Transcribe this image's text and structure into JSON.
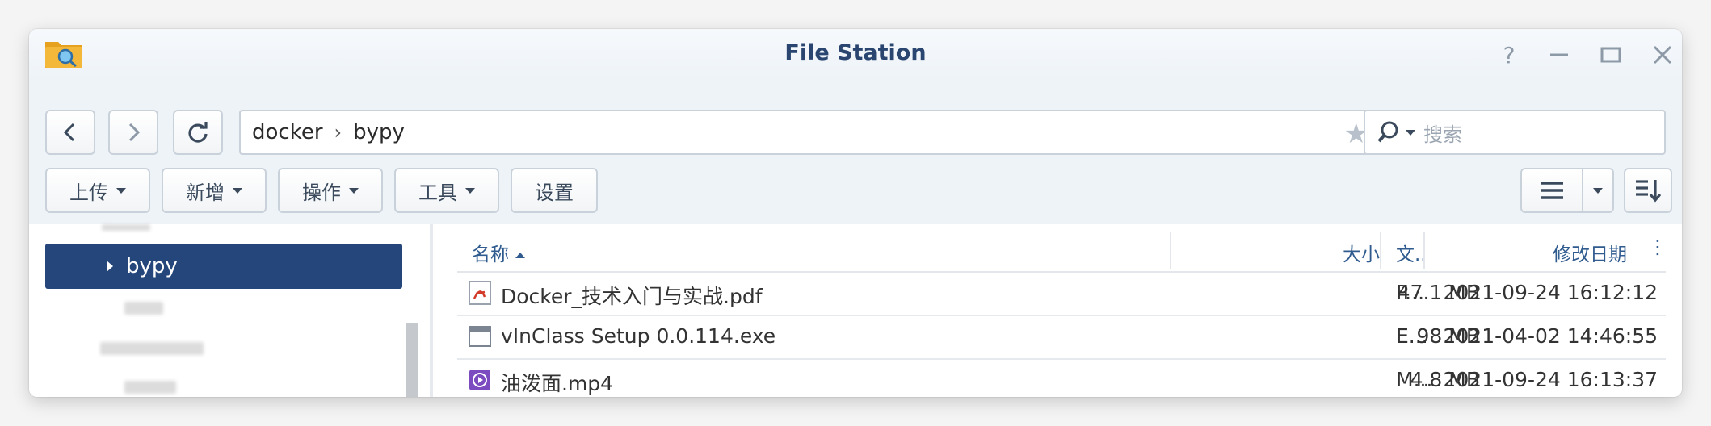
{
  "window": {
    "title": "File Station"
  },
  "nav": {
    "back": "‹",
    "forward": "›"
  },
  "path": {
    "segments": [
      "docker",
      "bypy"
    ],
    "separator": "›"
  },
  "search": {
    "placeholder": "搜索"
  },
  "actions": {
    "upload": "上传",
    "create": "新增",
    "operate": "操作",
    "tools": "工具",
    "settings": "设置"
  },
  "sidebar": {
    "selected": "bypy"
  },
  "columns": {
    "name": "名称",
    "size": "大小",
    "type": "文..",
    "modified": "修改日期"
  },
  "files": [
    {
      "name": "Docker_技术入门与实战.pdf",
      "size": "47.1 MB",
      "type": "P...",
      "modified": "2021-09-24 16:12:12",
      "icon": "pdf-file-icon"
    },
    {
      "name": "vInClass Setup 0.0.114.exe",
      "size": "98 MB",
      "type": "E...",
      "modified": "2021-04-02 14:46:55",
      "icon": "exe-file-icon"
    },
    {
      "name": "油泼面.mp4",
      "size": "4.8 MB",
      "type": "M...",
      "modified": "2021-09-24 16:13:37",
      "icon": "video-file-icon"
    }
  ],
  "colors": {
    "accent": "#24467b",
    "title": "#2a4670",
    "header": "#2f5b8f"
  }
}
